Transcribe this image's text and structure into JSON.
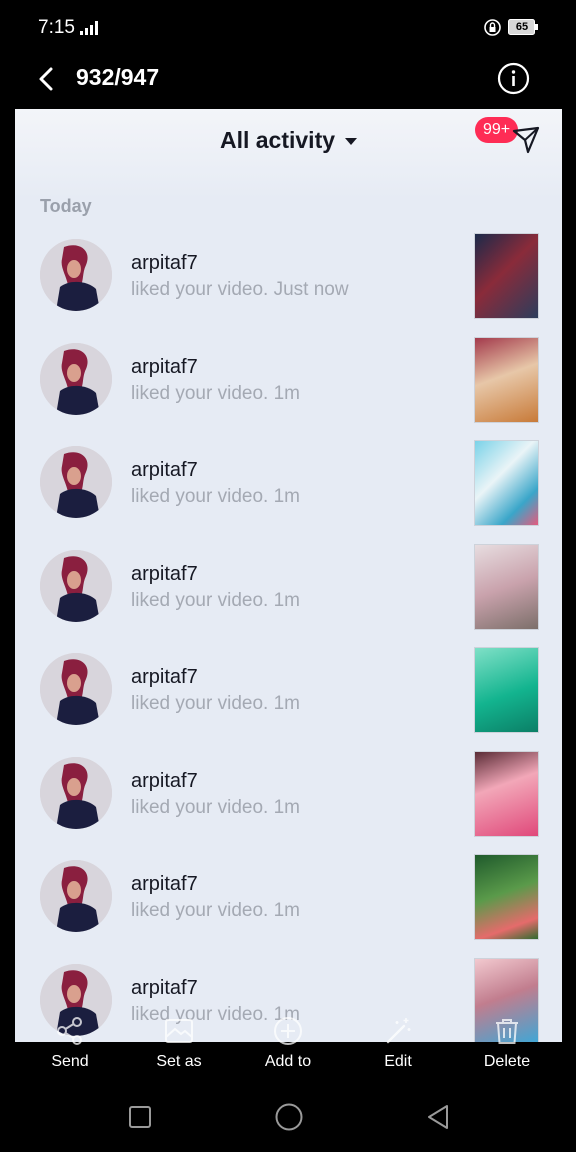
{
  "status_bar": {
    "time": "7:15",
    "battery": "65"
  },
  "viewer": {
    "counter": "932/947"
  },
  "screenshot": {
    "title": "All activity",
    "badge": "99+",
    "section_label": "Today",
    "notifications": [
      {
        "username": "arpitaf7",
        "text": "liked your video. Just now"
      },
      {
        "username": "arpitaf7",
        "text": "liked your video. 1m"
      },
      {
        "username": "arpitaf7",
        "text": "liked your video. 1m"
      },
      {
        "username": "arpitaf7",
        "text": "liked your video. 1m"
      },
      {
        "username": "arpitaf7",
        "text": "liked your video. 1m"
      },
      {
        "username": "arpitaf7",
        "text": "liked your video. 1m"
      },
      {
        "username": "arpitaf7",
        "text": "liked your video. 1m"
      },
      {
        "username": "arpitaf7",
        "text": "liked your video. 1m"
      }
    ]
  },
  "toolbar": {
    "send": "Send",
    "set_as": "Set as",
    "add_to": "Add to",
    "edit": "Edit",
    "delete": "Delete"
  },
  "colors": {
    "badge": "#fe2c55",
    "screenshot_bg": "#e6ebf4",
    "muted_text": "#a4a9b3"
  }
}
